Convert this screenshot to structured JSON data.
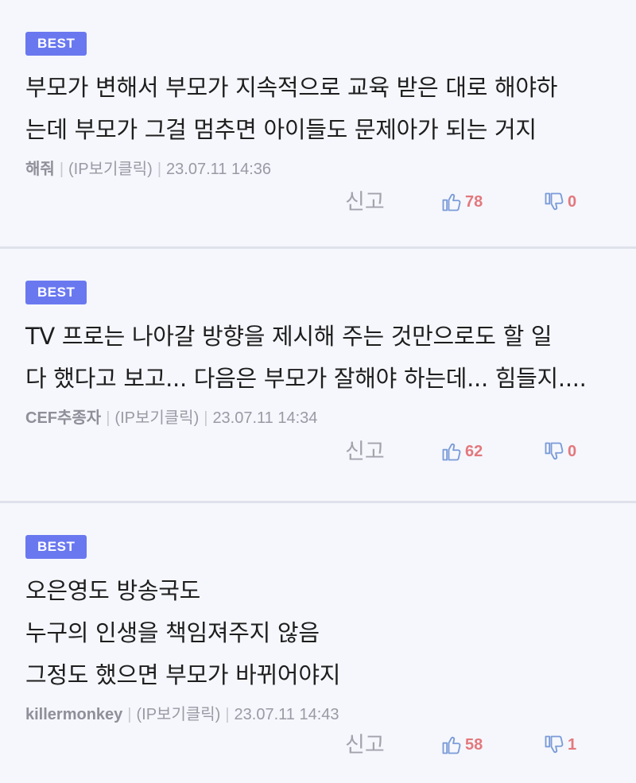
{
  "comments": [
    {
      "badge": "BEST",
      "lines": [
        "부모가 변해서 부모가 지속적으로 교육 받은 대로 해야하",
        "는데 부모가 그걸 멈추면 아이들도 문제아가 되는 거지"
      ],
      "author": "해줘",
      "ip": "(IP보기클릭)",
      "datetime": "23.07.11 14:36",
      "report_label": "신고",
      "likes": "78",
      "dislikes": "0"
    },
    {
      "badge": "BEST",
      "lines": [
        "TV 프로는 나아갈 방향을 제시해 주는 것만으로도 할 일",
        "다 했다고 보고... 다음은 부모가 잘해야 하는데... 힘들지...."
      ],
      "author": "CEF추종자",
      "ip": "(IP보기클릭)",
      "datetime": "23.07.11 14:34",
      "report_label": "신고",
      "likes": "62",
      "dislikes": "0"
    },
    {
      "badge": "BEST",
      "lines": [
        "오은영도 방송국도",
        "누구의 인생을 책임져주지 않음",
        "그정도 했으면 부모가 바뀌어야지"
      ],
      "author": "killermonkey",
      "ip": "(IP보기클릭)",
      "datetime": "23.07.11 14:43",
      "report_label": "신고",
      "likes": "58",
      "dislikes": "1"
    }
  ],
  "meta_separator": "|",
  "icons": {
    "like": "thumbs-up-icon",
    "dislike": "thumbs-down-icon"
  },
  "colors": {
    "badge": "#6a78f0",
    "count": "#e3787d",
    "icon": "#7b9bd8"
  }
}
